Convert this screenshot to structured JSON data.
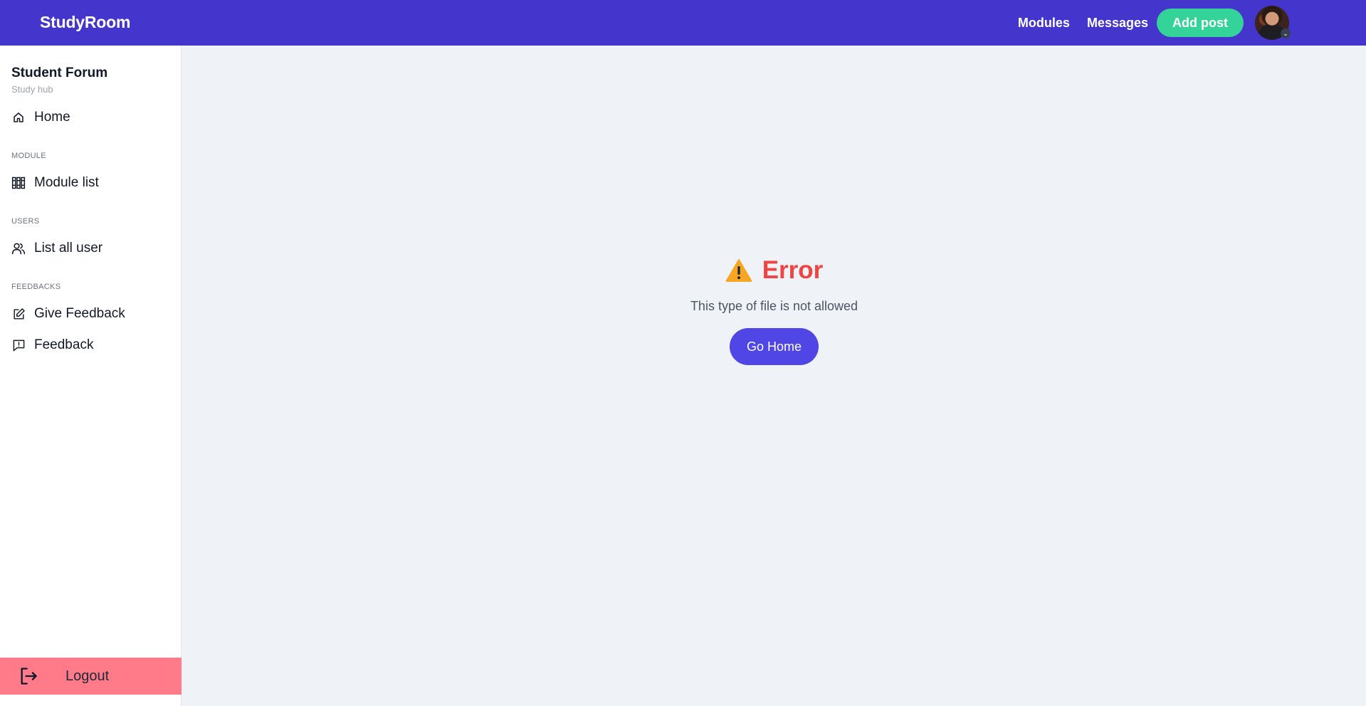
{
  "navbar": {
    "brand": "StudyRoom",
    "links": {
      "modules": "Modules",
      "messages": "Messages"
    },
    "add_post": "Add post",
    "colors": {
      "background": "#4436cc",
      "add_post": "#34d399"
    }
  },
  "sidebar": {
    "title": "Student Forum",
    "subtitle": "Study hub",
    "home": {
      "label": "Home",
      "icon": "home-icon"
    },
    "sections": {
      "module": "MODULE",
      "users": "USERS",
      "feedbacks": "FEEDBACKS"
    },
    "module_list": {
      "label": "Module list",
      "icon": "library-icon"
    },
    "list_all_user": {
      "label": "List all user",
      "icon": "users-icon"
    },
    "give_feedback": {
      "label": "Give Feedback",
      "icon": "edit-icon"
    },
    "feedback": {
      "label": "Feedback",
      "icon": "feedback-icon"
    },
    "logout": {
      "label": "Logout",
      "icon": "logout-icon",
      "color": "#ff7b8a"
    }
  },
  "error": {
    "title": "Error",
    "message": "This type of file is not allowed",
    "button": "Go Home",
    "icon": "warning-icon",
    "title_color": "#ef4444",
    "button_color": "#4f46e5"
  }
}
